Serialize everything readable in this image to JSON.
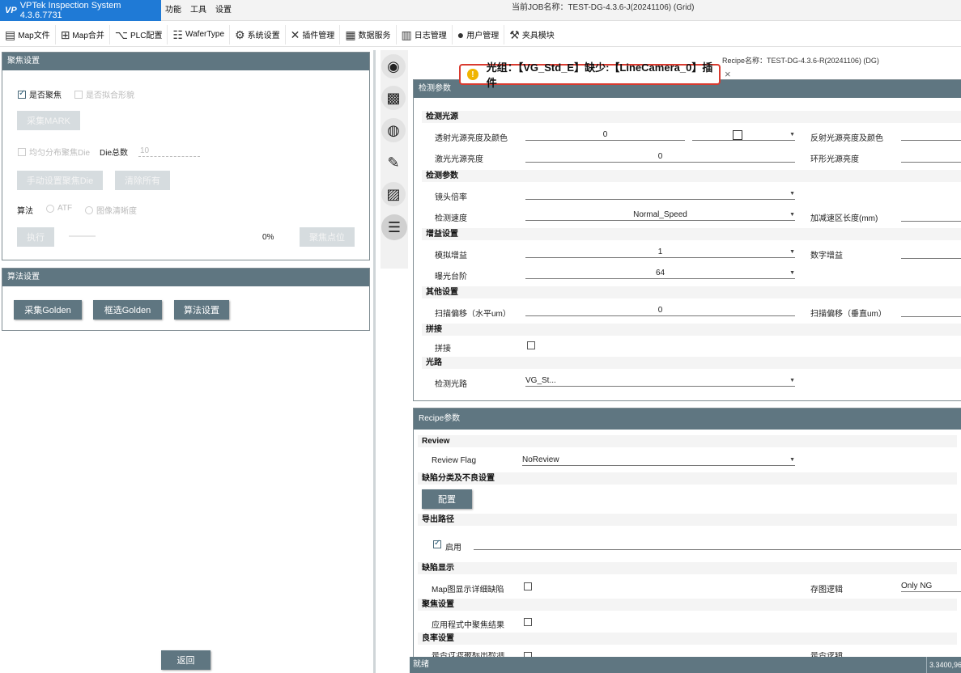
{
  "app": {
    "logo": "VP",
    "title": "VPTek Inspection System 4.3.6.7731"
  },
  "menu": [
    "功能",
    "工具",
    "设置"
  ],
  "job": "当前JOB名称：TEST-DG-4.3.6-J(20241106) (Grid)",
  "toolbar": [
    {
      "label": "Map文件",
      "icon": "document-icon"
    },
    {
      "label": "Map合并",
      "icon": "map-merge-icon"
    },
    {
      "label": "PLC配置",
      "icon": "plc-icon"
    },
    {
      "label": "WaferType",
      "icon": "grid-icon"
    },
    {
      "label": "系统设置",
      "icon": "gear-icon"
    },
    {
      "label": "插件管理",
      "icon": "tools-icon"
    },
    {
      "label": "数据服务",
      "icon": "data-service-icon"
    },
    {
      "label": "日志管理",
      "icon": "log-icon"
    },
    {
      "label": "用户管理",
      "icon": "user-icon"
    },
    {
      "label": "夹具模块",
      "icon": "fixture-icon"
    }
  ],
  "focus": {
    "header": "聚焦设置",
    "enable_focus": "是否聚焦",
    "fit_topology": "是否拟合形貌",
    "collect_mark": "采集MARK",
    "uniform_focus": "均匀分布聚焦Die",
    "die_total_label": "Die总数",
    "die_total_value": "10",
    "manual_die": "手动设置聚焦Die",
    "clear_all": "清除所有",
    "algo_label": "算法",
    "algo_atf": "ATF",
    "algo_clarity": "图像清晰度",
    "execute": "执行",
    "progress": "0%",
    "focus_point": "聚焦点位"
  },
  "algo": {
    "header": "算法设置",
    "collect_golden": "采集Golden",
    "select_golden": "框选Golden",
    "algo_settings": "算法设置"
  },
  "back": "返回",
  "recipe_name": "Recipe名称：TEST-DG-4.3.6-R(20241106) (DG)",
  "toast": "光组：【VG_Std_E】缺少:【LineCamera_0】插件",
  "inspect": {
    "header": "检测参数",
    "light_section": "检测光源",
    "trans_light": "透射光源亮度及颜色",
    "trans_value": "0",
    "refl_light": "反射光源亮度及颜色",
    "laser_light": "激光光源亮度",
    "laser_value": "0",
    "ring_light": "环形光源亮度",
    "param_section": "检测参数",
    "lens": "镜头倍率",
    "speed": "检测速度",
    "speed_value": "Normal_Speed",
    "accel": "加减速区长度(mm)",
    "gain_section": "增益设置",
    "analog_gain": "模拟增益",
    "analog_value": "1",
    "digital_gain": "数字增益",
    "exposure": "曝光台阶",
    "exposure_value": "64",
    "other_section": "其他设置",
    "scan_h": "扫描偏移（水平um）",
    "scan_h_value": "0",
    "scan_v": "扫描偏移（垂直um）",
    "stitch_section": "拼接",
    "stitch": "拼接",
    "optical_section": "光路",
    "optical_path": "检测光路",
    "optical_value": "VG_St..."
  },
  "recipe": {
    "header": "Recipe参数",
    "review_section": "Review",
    "review_flag": "Review Flag",
    "review_value": "NoReview",
    "defect_section": "缺陷分类及不良设置",
    "config": "配置",
    "export_section": "导出路径",
    "enable": "启用",
    "display_section": "缺陷显示",
    "map_detail": "Map图显示详细缺陷",
    "save_logic": "存图逻辑",
    "save_value": "Only NG",
    "focus_section": "聚焦设置",
    "apply_focus": "应用程式中聚焦结果",
    "yield_section": "良率设置",
    "yield_partial_1": "是否过滤被标出检测",
    "yield_partial_2": "是否逻辑"
  },
  "status": {
    "text": "就绪",
    "coord": "3.3400,96"
  }
}
